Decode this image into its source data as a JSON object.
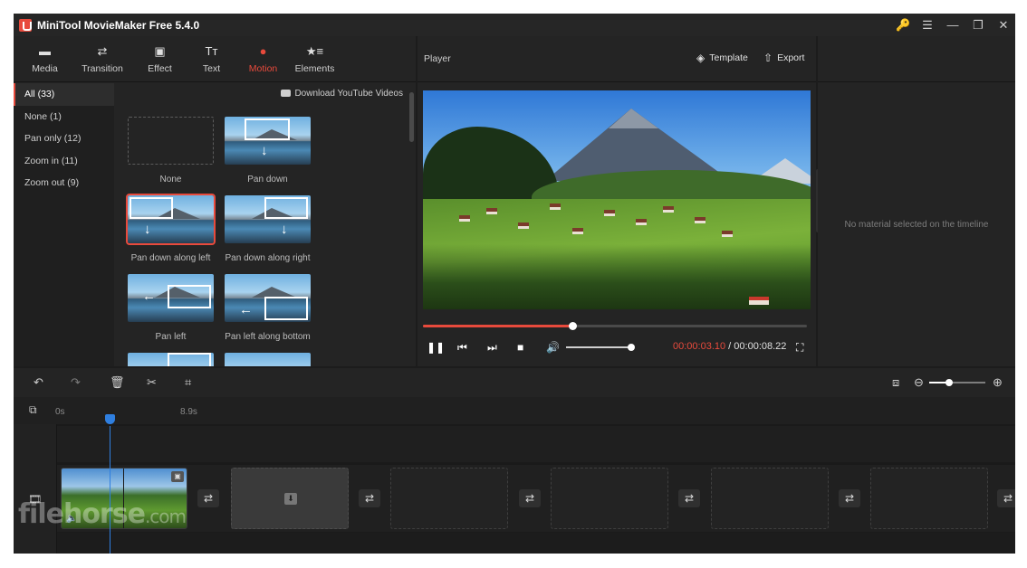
{
  "app": {
    "title": "MiniTool MovieMaker Free 5.4.0"
  },
  "window_controls": {
    "key": "🔑",
    "menu": "☰",
    "minimize": "—",
    "restore": "❐",
    "close": "✕"
  },
  "toolbar": [
    {
      "label": "Media",
      "icon": "▬"
    },
    {
      "label": "Transition",
      "icon": "⇄"
    },
    {
      "label": "Effect",
      "icon": "▣"
    },
    {
      "label": "Text",
      "icon": "Tт"
    },
    {
      "label": "Motion",
      "icon": "●"
    },
    {
      "label": "Elements",
      "icon": "★≡"
    }
  ],
  "accent_color": "#e84a3c",
  "categories": [
    {
      "label": "All (33)"
    },
    {
      "label": "None (1)"
    },
    {
      "label": "Pan only (12)"
    },
    {
      "label": "Zoom in (11)"
    },
    {
      "label": "Zoom out (9)"
    }
  ],
  "gallery": {
    "download_link": "Download YouTube Videos",
    "items": [
      {
        "caption": "None"
      },
      {
        "caption": "Pan down",
        "arrow": "↓"
      },
      {
        "caption": "Pan down along left",
        "arrow": "↓"
      },
      {
        "caption": "Pan down along right",
        "arrow": "↓"
      },
      {
        "caption": "Pan left",
        "arrow": "←"
      },
      {
        "caption": "Pan left along bottom",
        "arrow": "←"
      }
    ]
  },
  "player": {
    "title": "Player",
    "template_label": "Template",
    "export_label": "Export",
    "progress_fraction": 0.39,
    "volume_fraction": 1.0,
    "current_time": "00:00:03.10",
    "separator": " / ",
    "total_time": "00:00:08.22"
  },
  "properties": {
    "empty_message": "No material selected on the timeline"
  },
  "timeline": {
    "ruler_start": "0s",
    "ruler_mark": "8.9s",
    "zoom_fraction": 0.35
  },
  "watermark": {
    "text": "filehorse",
    "suffix": ".com"
  }
}
